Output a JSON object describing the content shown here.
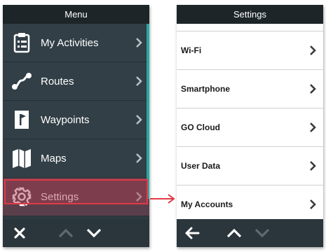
{
  "menu": {
    "title": "Menu",
    "items": [
      {
        "label": "My Activities",
        "icon": "clipboard-icon"
      },
      {
        "label": "Routes",
        "icon": "route-icon"
      },
      {
        "label": "Waypoints",
        "icon": "waypoint-flag-icon"
      },
      {
        "label": "Maps",
        "icon": "map-icon"
      },
      {
        "label": "Settings",
        "icon": "gear-icon"
      }
    ],
    "bottom": {
      "close": "close-icon",
      "up": "chevron-up-icon",
      "down": "chevron-down-icon"
    }
  },
  "settings": {
    "title": "Settings",
    "items": [
      {
        "label": "Wi-Fi"
      },
      {
        "label": "Smartphone"
      },
      {
        "label": "GO Cloud"
      },
      {
        "label": "User Data"
      },
      {
        "label": "My Accounts"
      }
    ],
    "bottom": {
      "back": "back-arrow-icon",
      "up": "chevron-up-icon",
      "down": "chevron-down-icon"
    }
  },
  "colors": {
    "menu_bg": "#323f46",
    "header_bg": "#1d2529",
    "accent_teal": "#2aa6a0",
    "highlight_red": "#e03a48",
    "settings_bg": "#ffffff"
  }
}
